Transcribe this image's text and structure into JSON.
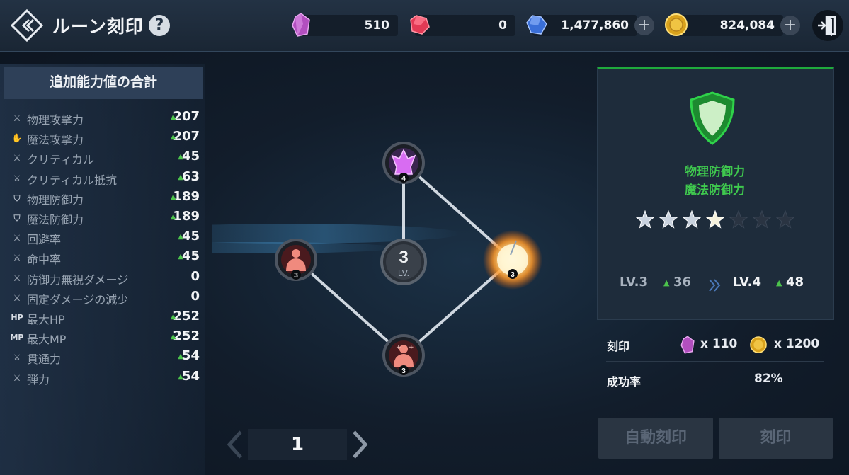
{
  "header": {
    "title": "ルーン刻印",
    "help": "?",
    "currencies": [
      {
        "icon": "purple-crystal-icon",
        "value": "510"
      },
      {
        "icon": "red-gem-icon",
        "value": "0"
      },
      {
        "icon": "blue-gem-icon",
        "value": "1,477,860"
      },
      {
        "icon": "gold-coin-icon",
        "value": "824,084"
      }
    ],
    "plus": "+"
  },
  "stats": {
    "title": "追加能力値の合計",
    "rows": [
      {
        "icon": "swords-icon",
        "name": "物理攻撃力",
        "value": "207"
      },
      {
        "icon": "magic-hand-icon",
        "name": "魔法攻撃力",
        "value": "207"
      },
      {
        "icon": "swords-icon",
        "name": "クリティカル",
        "value": "45"
      },
      {
        "icon": "swords-icon",
        "name": "クリティカル抵抗",
        "value": "63"
      },
      {
        "icon": "p-shield-icon",
        "name": "物理防御力",
        "value": "189"
      },
      {
        "icon": "w-shield-icon",
        "name": "魔法防御力",
        "value": "189"
      },
      {
        "icon": "swords-icon",
        "name": "回避率",
        "value": "45"
      },
      {
        "icon": "swords-icon",
        "name": "命中率",
        "value": "45"
      },
      {
        "icon": "swords-icon",
        "name": "防御力無視ダメージ",
        "value": "0"
      },
      {
        "icon": "swords-icon",
        "name": "固定ダメージの減少",
        "value": "0"
      },
      {
        "icon": "hp-icon",
        "name": "最大HP",
        "value": "252",
        "tag": "HP"
      },
      {
        "icon": "mp-icon",
        "name": "最大MP",
        "value": "252",
        "tag": "MP"
      },
      {
        "icon": "swords-icon",
        "name": "貫通力",
        "value": "54"
      },
      {
        "icon": "swords-icon",
        "name": "弾力",
        "value": "54"
      }
    ]
  },
  "graph": {
    "center_level": "3",
    "center_label": "LV.",
    "nodes": [
      {
        "name": "top",
        "level": "4"
      },
      {
        "name": "left",
        "level": "3"
      },
      {
        "name": "right",
        "level": "3"
      },
      {
        "name": "bottom",
        "level": "3"
      }
    ]
  },
  "detail": {
    "effects": [
      "物理防御力",
      "魔法防御力"
    ],
    "stars_filled": 4,
    "stars_total": 7,
    "lv_from": "LV.3",
    "val_from": "36",
    "lv_to": "LV.4",
    "val_to": "48",
    "cost_label": "刻印",
    "cost_crystal": "x 110",
    "cost_gold": "x 1200",
    "rate_label": "成功率",
    "rate_value": "82%",
    "auto_button": "自動刻印",
    "engrave_button": "刻印"
  },
  "pager": {
    "page": "1"
  },
  "colors": {
    "accent_green": "#1faa3c",
    "effect_green": "#3fc84e",
    "up_green": "#4cc34c"
  }
}
